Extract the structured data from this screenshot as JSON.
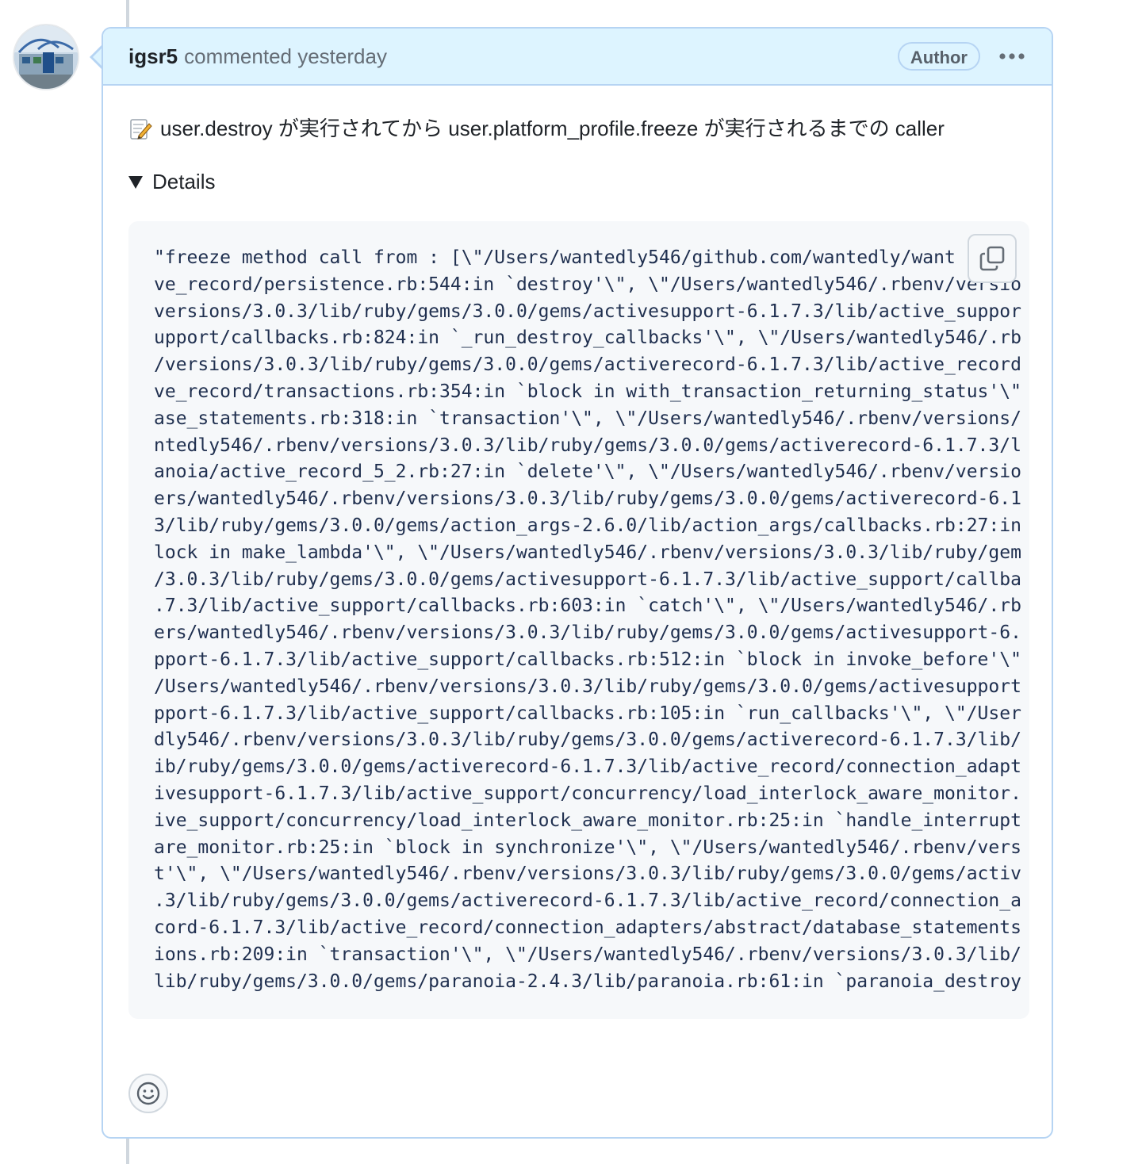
{
  "comment": {
    "author": "igsr5",
    "meta": "commented yesterday",
    "badge": "Author",
    "body_text": "user.destroy が実行されてから user.platform_profile.freeze が実行されるまでの caller",
    "body_icon": "memo-icon",
    "details_label": "Details",
    "code_lines": [
      "\"freeze method call from : [\\\"/Users/wantedly546/github.com/wantedly/want \\\"/l",
      "ve_record/persistence.rb:544:in `destroy'\\\", \\\"/Users/wantedly546/.rbenv/versio",
      "versions/3.0.3/lib/ruby/gems/3.0.0/gems/activesupport-6.1.7.3/lib/active_suppor",
      "upport/callbacks.rb:824:in `_run_destroy_callbacks'\\\", \\\"/Users/wantedly546/.rb",
      "/versions/3.0.3/lib/ruby/gems/3.0.0/gems/activerecord-6.1.7.3/lib/active_record",
      "ve_record/transactions.rb:354:in `block in with_transaction_returning_status'\\\"",
      "ase_statements.rb:318:in `transaction'\\\", \\\"/Users/wantedly546/.rbenv/versions/",
      "ntedly546/.rbenv/versions/3.0.3/lib/ruby/gems/3.0.0/gems/activerecord-6.1.7.3/l",
      "anoia/active_record_5_2.rb:27:in `delete'\\\", \\\"/Users/wantedly546/.rbenv/versio",
      "ers/wantedly546/.rbenv/versions/3.0.3/lib/ruby/gems/3.0.0/gems/activerecord-6.1",
      "3/lib/ruby/gems/3.0.0/gems/action_args-2.6.0/lib/action_args/callbacks.rb:27:in",
      "lock in make_lambda'\\\", \\\"/Users/wantedly546/.rbenv/versions/3.0.3/lib/ruby/gem",
      "/3.0.3/lib/ruby/gems/3.0.0/gems/activesupport-6.1.7.3/lib/active_support/callba",
      ".7.3/lib/active_support/callbacks.rb:603:in `catch'\\\", \\\"/Users/wantedly546/.rb",
      "ers/wantedly546/.rbenv/versions/3.0.3/lib/ruby/gems/3.0.0/gems/activesupport-6.",
      "pport-6.1.7.3/lib/active_support/callbacks.rb:512:in `block in invoke_before'\\\"",
      "/Users/wantedly546/.rbenv/versions/3.0.3/lib/ruby/gems/3.0.0/gems/activesupport",
      "pport-6.1.7.3/lib/active_support/callbacks.rb:105:in `run_callbacks'\\\", \\\"/User",
      "dly546/.rbenv/versions/3.0.3/lib/ruby/gems/3.0.0/gems/activerecord-6.1.7.3/lib/",
      "ib/ruby/gems/3.0.0/gems/activerecord-6.1.7.3/lib/active_record/connection_adapt",
      "ivesupport-6.1.7.3/lib/active_support/concurrency/load_interlock_aware_monitor.",
      "ive_support/concurrency/load_interlock_aware_monitor.rb:25:in `handle_interrupt",
      "are_monitor.rb:25:in `block in synchronize'\\\", \\\"/Users/wantedly546/.rbenv/vers",
      "t'\\\", \\\"/Users/wantedly546/.rbenv/versions/3.0.3/lib/ruby/gems/3.0.0/gems/activ",
      ".3/lib/ruby/gems/3.0.0/gems/activerecord-6.1.7.3/lib/active_record/connection_a",
      "cord-6.1.7.3/lib/active_record/connection_adapters/abstract/database_statements",
      "ions.rb:209:in `transaction'\\\", \\\"/Users/wantedly546/.rbenv/versions/3.0.3/lib/",
      "lib/ruby/gems/3.0.0/gems/paranoia-2.4.3/lib/paranoia.rb:61:in `paranoia_destroy"
    ]
  },
  "icons": {
    "more": "kebab-horizontal-icon",
    "copy": "copy-icon",
    "reaction": "smiley-icon",
    "details": "triangle-down-icon"
  },
  "colors": {
    "header_bg": "#ddf4ff",
    "header_border": "#b6d4f3",
    "code_bg": "#f6f8fa",
    "code_text": "#1f2f4f",
    "muted_text": "#656d76"
  }
}
